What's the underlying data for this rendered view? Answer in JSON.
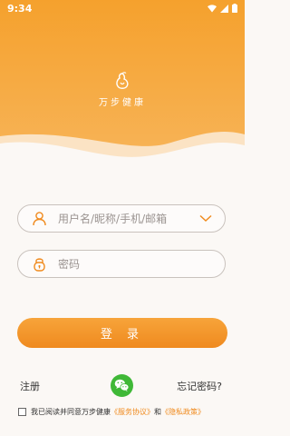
{
  "status_bar": {
    "time": "9:34"
  },
  "app": {
    "name": "万步健康"
  },
  "form": {
    "username_placeholder": "用户名/昵称/手机/邮箱",
    "password_placeholder": "密码"
  },
  "buttons": {
    "login_label": "登 录"
  },
  "links": {
    "register": "注册",
    "forgot_password": "忘记密码?"
  },
  "agreement": {
    "prefix": "我已阅读并同意万步健康",
    "service_link": "《服务协议》",
    "conjunction": "和",
    "privacy_link": "《隐私政策》"
  },
  "icons": [
    "wifi-icon",
    "signal-icon",
    "battery-icon",
    "app-logo-icon",
    "user-icon",
    "chevron-down-icon",
    "lock-icon",
    "wechat-icon"
  ],
  "colors": {
    "accent": "#f08a1d",
    "header_top": "#f5a12d",
    "background": "#fbf8f5"
  }
}
